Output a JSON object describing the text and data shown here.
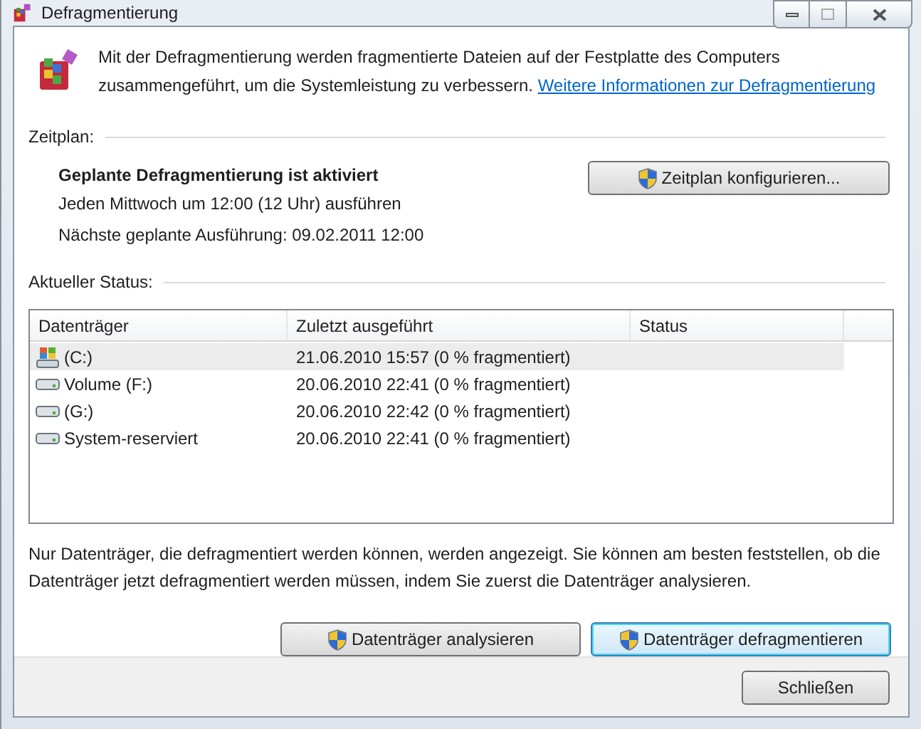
{
  "window": {
    "title": "Defragmentierung"
  },
  "intro": {
    "text": "Mit der Defragmentierung werden fragmentierte Dateien auf der Festplatte des Computers zusammengeführt, um die Systemleistung zu verbessern.",
    "link": "Weitere Informationen zur Defragmentierung"
  },
  "schedule": {
    "heading": "Zeitplan:",
    "status": "Geplante Defragmentierung ist aktiviert",
    "lines": [
      "Jeden Mittwoch um 12:00 (12 Uhr) ausführen",
      "Nächste geplante Ausführung: 09.02.2011 12:00"
    ],
    "button": {
      "label": "Zeitplan konfigurieren...",
      "shield": true,
      "default": false
    }
  },
  "current_status": {
    "heading": "Aktueller Status:",
    "table": {
      "columns": [
        "Datenträger",
        "Zuletzt ausgeführt",
        "Status"
      ],
      "rows": [
        {
          "kind": "system",
          "name": "(C:)",
          "last_run": "21.06.2010 15:57 (0 % fragmentiert)",
          "selected": true
        },
        {
          "kind": "drive",
          "name": "Volume (F:)",
          "last_run": "20.06.2010 22:41 (0 % fragmentiert)",
          "selected": false
        },
        {
          "kind": "drive",
          "name": "(G:)",
          "last_run": "20.06.2010 22:42 (0 % fragmentiert)",
          "selected": false
        },
        {
          "kind": "drive",
          "name": "System-reserviert",
          "last_run": "20.06.2010 22:41 (0 % fragmentiert)",
          "selected": false
        }
      ]
    }
  },
  "note": "Nur Datenträger, die defragmentiert werden können, werden angezeigt. Sie können am besten feststellen, ob die Datenträger jetzt defragmentiert werden müssen, indem Sie zuerst die Datenträger analysieren.",
  "actions": [
    {
      "label": "Datenträger analysieren",
      "shield": true,
      "default": false
    },
    {
      "label": "Datenträger defragmentieren",
      "shield": true,
      "default": true
    }
  ],
  "footer": {
    "close_button": "Schließen"
  }
}
